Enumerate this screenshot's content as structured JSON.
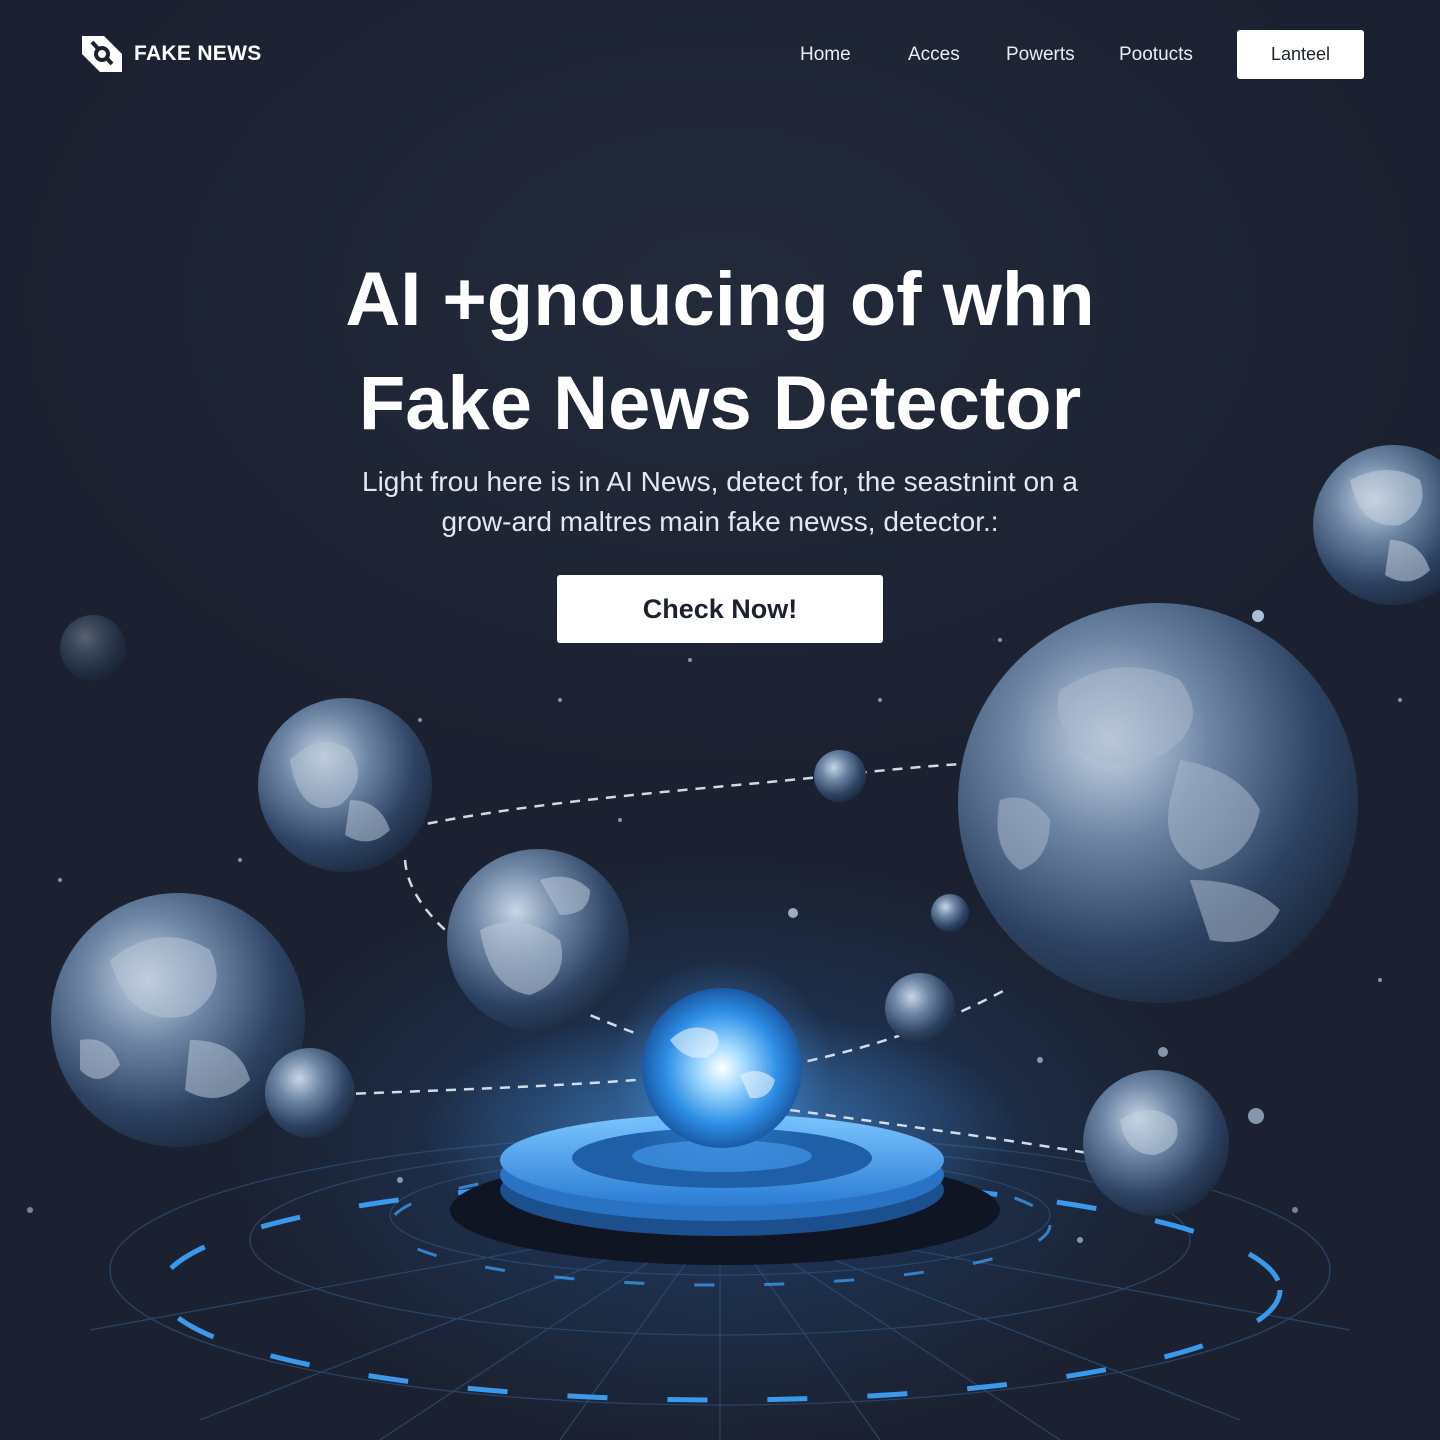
{
  "brand": {
    "name": "FAKE NEWS",
    "logo_icon": "fake-news-logo-icon"
  },
  "nav": {
    "items": [
      {
        "label": "Home"
      },
      {
        "label": "Acces"
      },
      {
        "label": "Powerts"
      },
      {
        "label": "Pootucts"
      }
    ],
    "cta_label": "Lanteel"
  },
  "hero": {
    "title_line1": "AI +gnoucing of whn",
    "title_line2": "Fake News Detector",
    "subtitle_line1": "Light frou here is in AI News, detect for, the seastnint on a",
    "subtitle_line2": "grow-ard maltres main fake newss, detector.:",
    "cta_label": "Check Now!"
  },
  "illustration": {
    "name": "globe-network-illustration",
    "accent_color": "#3ea6ff",
    "background_color": "#1b2130"
  }
}
